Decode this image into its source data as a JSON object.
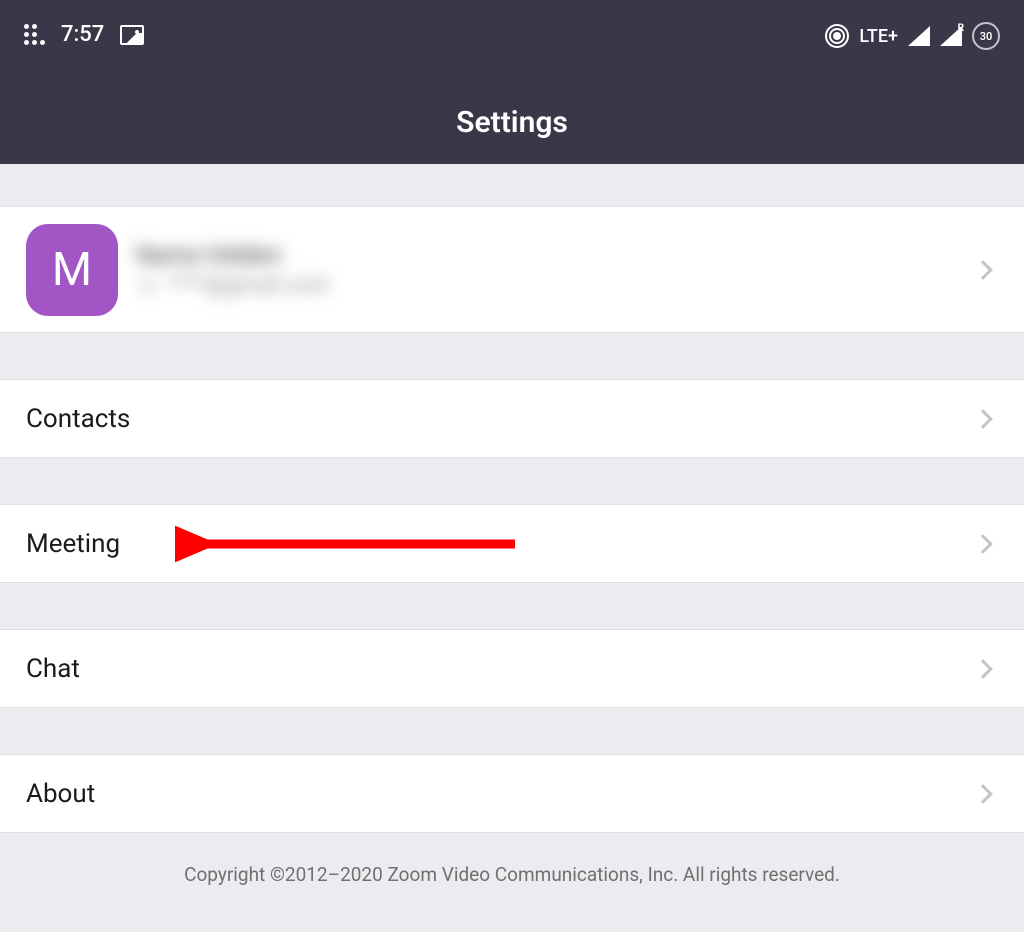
{
  "status": {
    "time": "7:57",
    "network": "LTE+",
    "battery": "30"
  },
  "header": {
    "title": "Settings"
  },
  "profile": {
    "avatar_initial": "M",
    "name": "Name Hidden",
    "email": "****@gmail.com"
  },
  "menu": {
    "contacts": "Contacts",
    "meeting": "Meeting",
    "chat": "Chat",
    "about": "About"
  },
  "footer": {
    "copyright": "Copyright ©2012–2020 Zoom Video Communications, Inc. All rights reserved."
  }
}
